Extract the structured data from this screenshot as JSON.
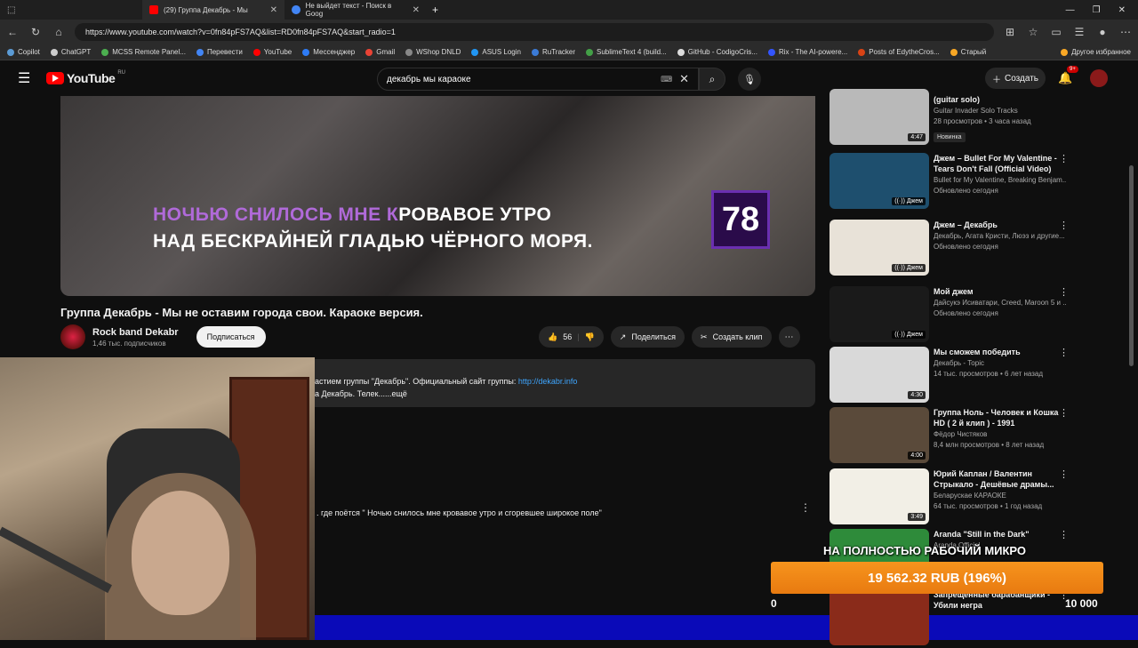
{
  "browser": {
    "tabs": [
      {
        "label": "(29) Группа Декабрь - Мы",
        "active": true,
        "favicon_color": "#ff0000"
      },
      {
        "label": "Не выйдет текст - Поиск в Goog",
        "active": false,
        "favicon_color": "#4285f4"
      }
    ],
    "new_tab": "+",
    "url": "https://www.youtube.com/watch?v=0fn84pFS7AQ&list=RD0fn84pFS7AQ&start_radio=1",
    "bookmarks": [
      {
        "label": "Copilot",
        "color": "#5b9bd5"
      },
      {
        "label": "ChatGPT",
        "color": "#cccccc"
      },
      {
        "label": "MCSS Remote Panel...",
        "color": "#4caf50"
      },
      {
        "label": "Перевести",
        "color": "#4285f4"
      },
      {
        "label": "YouTube",
        "color": "#ff0000"
      },
      {
        "label": "Мессенджер",
        "color": "#2e7cf6"
      },
      {
        "label": "Gmail",
        "color": "#ea4335"
      },
      {
        "label": "WShop DNLD",
        "color": "#888888"
      },
      {
        "label": "ASUS Login",
        "color": "#2196f3"
      },
      {
        "label": "RuTracker",
        "color": "#3b7bd6"
      },
      {
        "label": "SublimeText 4 (build...",
        "color": "#43a047"
      },
      {
        "label": "GitHub - CodigoCris...",
        "color": "#dddddd"
      },
      {
        "label": "Rix - The AI-powere...",
        "color": "#3355ff"
      },
      {
        "label": "Posts of EdytheCros...",
        "color": "#d84315"
      },
      {
        "label": "Старый",
        "color": "#f9a825"
      },
      {
        "label": "Другое избранное",
        "color": "#f9a825"
      }
    ]
  },
  "youtube": {
    "logo_text": "YouTube",
    "region": "RU",
    "search_query": "декабрь мы караоке",
    "create_label": "Создать",
    "notif_count": "9+"
  },
  "video": {
    "lyric_highlight": "НОЧЬЮ СНИЛОСЬ МНЕ К",
    "lyric_rest": "РОВАВОЕ УТРО",
    "lyric_line2": "НАД БЕСКРАЙНЕЙ ГЛАДЬЮ ЧЁРНОГО МОРЯ.",
    "channel_logo": "78",
    "title": "Группа Декабрь - Мы не оставим города свои. Караоке версия.",
    "channel_name": "Rock band Dekabr",
    "channel_subs": "1,46 тыс. подписчиков",
    "subscribe_label": "Подписаться",
    "likes": "56",
    "share_label": "Поделиться",
    "clip_label": "Создать клип",
    "desc_line1": "астием группы \"Декабрь\". Официальный сайт группы:",
    "desc_link": "http://dekabr.info",
    "desc_line2": "а  Декабрь. Телек......ещё",
    "comment_text": ". где поётся \" Ночью снилось мне кровавое утро и сгоревшее широкое поле\""
  },
  "recommendations": [
    {
      "title": "(guitar solo)",
      "meta1": "Guitar Invader Solo Tracks",
      "meta2": "28 просмотров • 3 часа назад",
      "tag": "Новинка",
      "duration": "4:47",
      "thumb": "#b9b9b9"
    },
    {
      "title": "Джем – Bullet For My Valentine - Tears Don't Fall (Official Video)",
      "meta1": "Bullet for My Valentine, Breaking Benjam...",
      "meta2": "Обновлено сегодня",
      "mix": "Джем",
      "thumb": "#1e4f6e"
    },
    {
      "title": "Джем – Декабрь",
      "meta1": "Декабрь, Агата Кристи, Люэз и другие...",
      "meta2": "Обновлено сегодня",
      "mix": "Джем",
      "thumb": "#e8e2d8"
    },
    {
      "title": "Мой джем",
      "meta1": "Дайсукэ Исиватари, Creed, Maroon 5 и ...",
      "meta2": "Обновлено сегодня",
      "mix": "Джем",
      "thumb": "#1a1a1a"
    },
    {
      "title": "Мы сможем победить",
      "meta1": "Декабрь - Topic",
      "meta2": "14 тыс. просмотров • 6 лет назад",
      "duration": "4:30",
      "thumb": "#d9d9d9"
    },
    {
      "title": "Группа Ноль - Человек и Кошка HD ( 2 й клип ) - 1991",
      "meta1": "Фёдор Чистяков",
      "meta2": "8,4 млн просмотров • 8 лет назад",
      "duration": "4:00",
      "thumb": "#5a4a3a"
    },
    {
      "title": "Юрий Каплан / Валентин Стрыкало - Дешёвые драмы...",
      "meta1": "Беларускае КАРАОКЕ",
      "meta2": "64 тыс. просмотров • 1 год назад",
      "duration": "3:49",
      "thumb": "#f2efe6"
    },
    {
      "title": "Aranda \"Still in the Dark\"",
      "meta1": "Aranda Official",
      "meta2": "",
      "thumb": "#2e8b3a"
    },
    {
      "title": "Запрещенные барабанщики - Убили негра",
      "meta1": "",
      "meta2": "",
      "thumb": "#8a2b1a"
    }
  ],
  "donation": {
    "message": "НА ПОЛНОСТЬЮ РАБОЧИЙ МИКРО",
    "amount": "19 562.32 RUB (196%)",
    "progress": 1.96,
    "min_label": "0",
    "max_label": "10 000",
    "color": "#f7941d"
  }
}
